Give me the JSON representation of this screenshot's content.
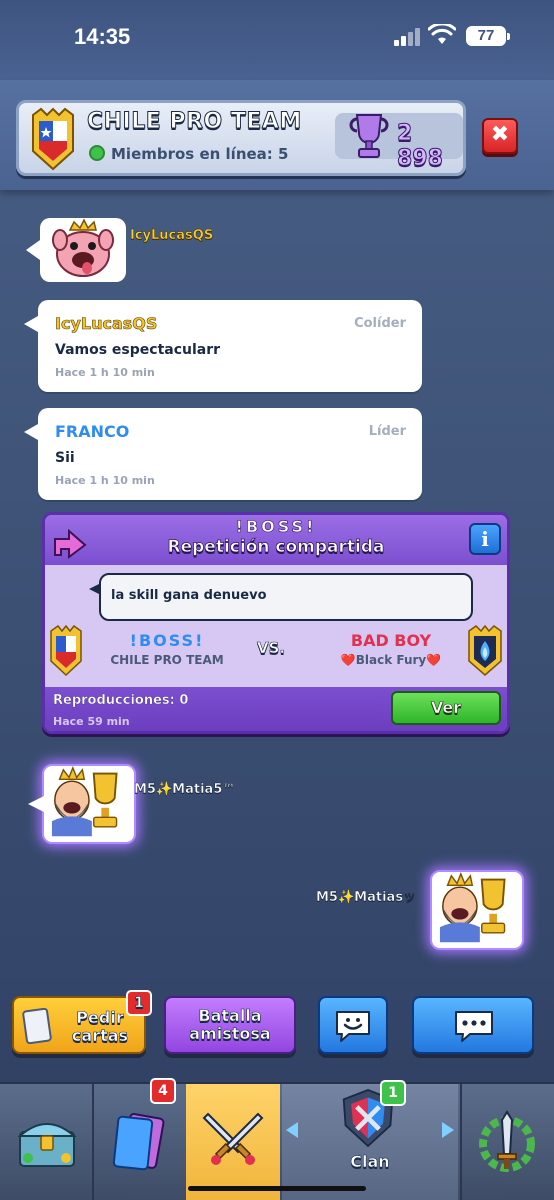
{
  "status_bar": {
    "time": "14:35",
    "battery": "77"
  },
  "clan_header": {
    "name": "CHILE PRO TEAM",
    "online_label": "Miembros en línea: 5",
    "trophies": "2 898",
    "close_label": "✖"
  },
  "chat": {
    "join_player": "IcyLucasQS",
    "messages": [
      {
        "author": "IcyLucasQS",
        "role": "Colíder",
        "text": "Vamos espectacularr",
        "time": "Hace 1 h 10 min"
      },
      {
        "author": "FRANCO",
        "role": "Líder",
        "text": "Sii",
        "time": "Hace 1 h 10 min"
      }
    ],
    "replay": {
      "title_player": "!BOSS!",
      "title": "Repetición compartida",
      "info_label": "i",
      "comment": "la skill gana denuevo",
      "player1": {
        "name": "!BOSS!",
        "clan": "CHILE PRO TEAM"
      },
      "vs_label": "VS.",
      "player2": {
        "name": "BAD BOY",
        "clan": "❤️Black Fury❤️"
      },
      "plays_label": "Reproducciones: 0",
      "time": "Hace 59 min",
      "watch_label": "Ver"
    },
    "emote_player_1": "M5✨Matia5™",
    "emote_player_2": "M5✨Matiasッ"
  },
  "actions": {
    "request_cards": "Pedir cartas",
    "request_badge": "1",
    "friendly_battle": "Batalla amistosa"
  },
  "nav": {
    "cards_badge": "4",
    "clan_badge": "1",
    "clan_label": "Clan"
  },
  "colors": {
    "accent_purple": "#7c4fd0",
    "green_button": "#2fb52a",
    "online": "#3ec24a",
    "nav_active": "#f0b43a"
  }
}
